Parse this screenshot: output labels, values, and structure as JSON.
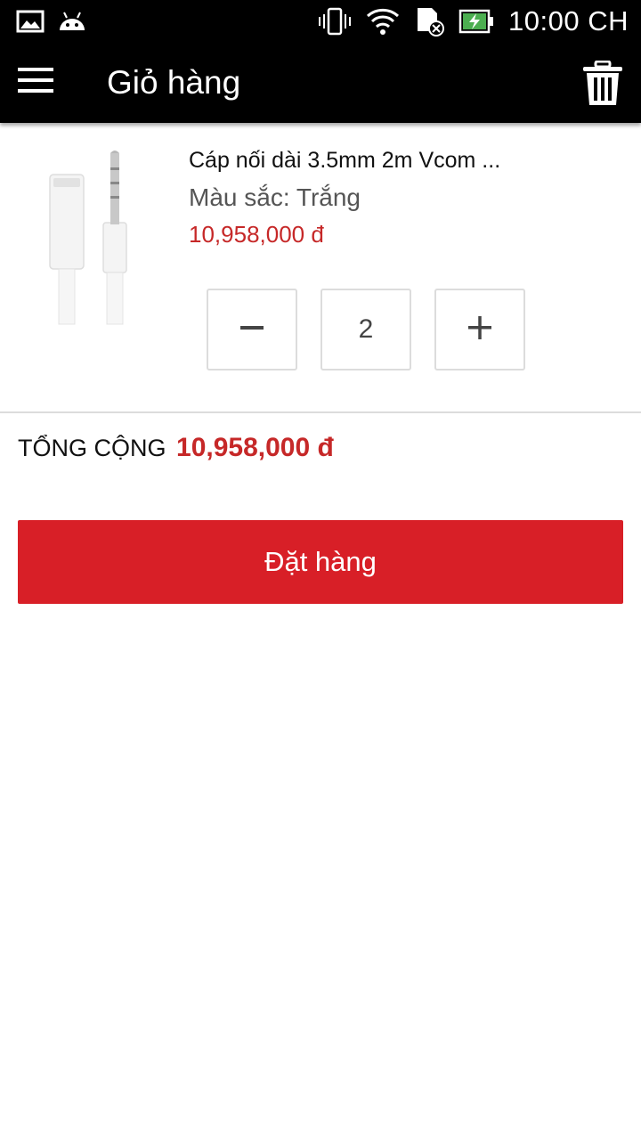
{
  "status_bar": {
    "time": "10:00 CH",
    "icons": [
      "gallery-icon",
      "android-icon",
      "vibrate-icon",
      "wifi-icon",
      "sd-card-error-icon",
      "battery-charging-icon"
    ]
  },
  "app_bar": {
    "title": "Giỏ hàng",
    "icons": [
      "menu-icon",
      "trash-icon"
    ]
  },
  "cart": {
    "items": [
      {
        "name": "Cáp nối dài 3.5mm 2m Vcom ...",
        "variant": "Màu sắc: Trắng",
        "price": "10,958,000 đ",
        "quantity": "2",
        "minus_label": "−",
        "plus_label": "+"
      }
    ]
  },
  "summary": {
    "total_label": "TỔNG CỘNG",
    "total_value": "10,958,000 đ"
  },
  "actions": {
    "order_label": "Đặt hàng"
  },
  "colors": {
    "accent": "#d81f27",
    "price": "#c62828",
    "bar_bg": "#000000"
  }
}
